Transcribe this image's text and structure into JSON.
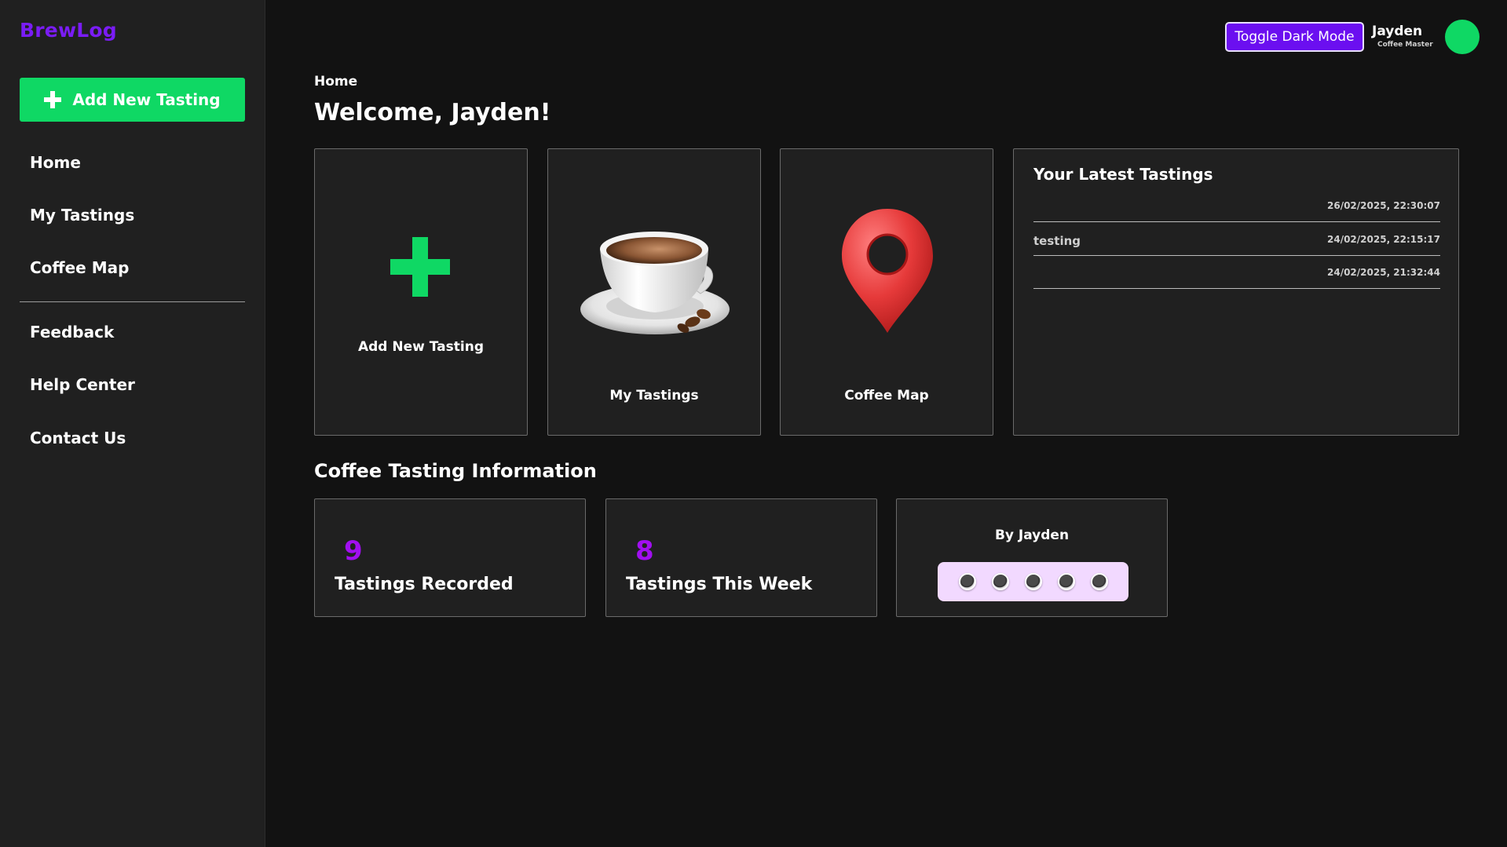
{
  "app": {
    "name": "BrewLog"
  },
  "sidebar": {
    "add_button_label": "Add New Tasting",
    "items": [
      {
        "label": "Home"
      },
      {
        "label": "My Tastings"
      },
      {
        "label": "Coffee Map"
      },
      {
        "label": "Feedback"
      },
      {
        "label": "Help Center"
      },
      {
        "label": "Contact Us"
      }
    ]
  },
  "header": {
    "toggle_label": "Toggle Dark Mode",
    "user_name": "Jayden",
    "user_role": "Coffee Master"
  },
  "main": {
    "breadcrumb": "Home",
    "welcome": "Welcome, Jayden!",
    "cards": [
      {
        "label": "Add New Tasting",
        "icon": "plus-icon"
      },
      {
        "label": "My Tastings",
        "icon": "coffee-cup-icon"
      },
      {
        "label": "Coffee Map",
        "icon": "map-pin-icon"
      }
    ],
    "latest": {
      "title": "Your Latest Tastings",
      "rows": [
        {
          "name": "",
          "date": "26/02/2025, 22:30:07"
        },
        {
          "name": "testing",
          "date": "24/02/2025, 22:15:17"
        },
        {
          "name": "",
          "date": "24/02/2025, 21:32:44"
        }
      ]
    },
    "info": {
      "title": "Coffee Tasting Information",
      "stats": [
        {
          "value": "9",
          "label": "Tastings Recorded"
        },
        {
          "value": "8",
          "label": "Tastings This Week"
        }
      ],
      "byline": "By Jayden",
      "rating": {
        "filled": 0,
        "total": 5
      }
    }
  },
  "colors": {
    "accent_green": "#0fd864",
    "accent_purple": "#6b0ff0",
    "brand_purple": "#7a1cf5",
    "stat_purple": "#a10ff0",
    "background": "#121212",
    "panel": "#202020",
    "rating_bg": "#f2d9ff"
  }
}
